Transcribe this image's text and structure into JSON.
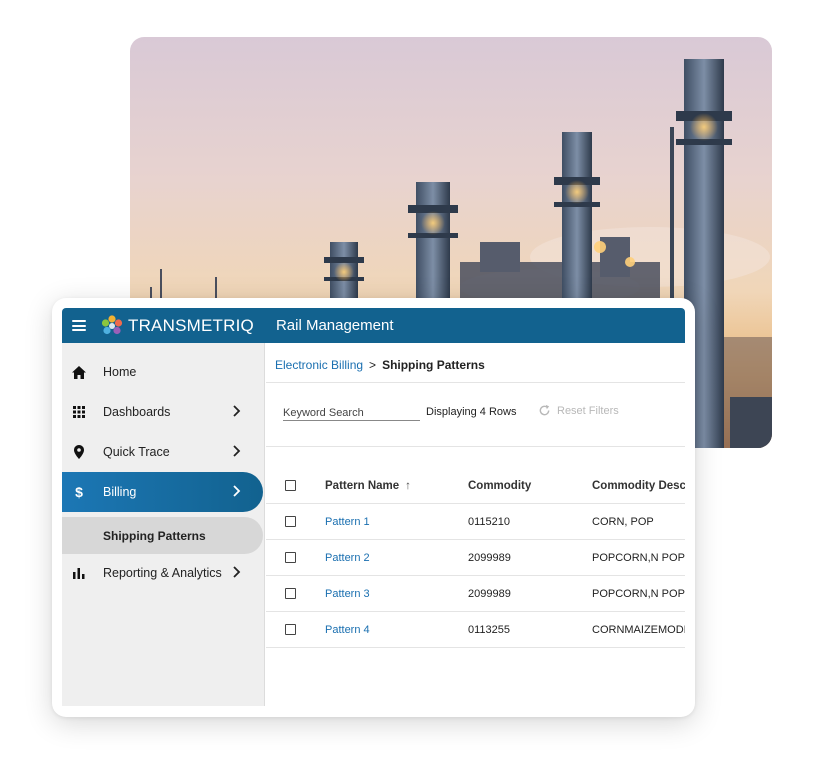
{
  "topbar": {
    "brand": "TRANSMETRIQ",
    "product": "Rail Management"
  },
  "sidebar": {
    "items": [
      {
        "label": "Home",
        "icon": "home-icon"
      },
      {
        "label": "Dashboards",
        "icon": "grid-icon"
      },
      {
        "label": "Quick Trace",
        "icon": "location-pin-icon"
      },
      {
        "label": "Billing",
        "icon": "dollar-icon"
      },
      {
        "label": "Reporting & Analytics",
        "icon": "bar-chart-icon"
      }
    ],
    "sub_item": "Shipping Patterns"
  },
  "breadcrumb": {
    "parent": "Electronic Billing",
    "separator": ">",
    "current": "Shipping Patterns"
  },
  "toolbar": {
    "search_placeholder": "Keyword Search",
    "rows_count": "Displaying 4 Rows",
    "reset_label": "Reset Filters"
  },
  "table": {
    "columns": [
      "Pattern Name",
      "Commodity",
      "Commodity Descri"
    ],
    "sort_arrow": "↑",
    "rows": [
      {
        "name": "Pattern 1",
        "commodity": "0115210",
        "description": "CORN, POP"
      },
      {
        "name": "Pattern 2",
        "commodity": "2099989",
        "description": "POPCORN,N POPPD"
      },
      {
        "name": "Pattern 3",
        "commodity": "2099989",
        "description": "POPCORN,N POPPD"
      },
      {
        "name": "Pattern 4",
        "commodity": "0113255",
        "description": "CORNMAIZEMODIFI"
      }
    ]
  },
  "colors": {
    "topbar": "#12628f",
    "active_nav": "#1c77b5",
    "link": "#1a6fb0",
    "sidebar_bg": "#efefef"
  }
}
